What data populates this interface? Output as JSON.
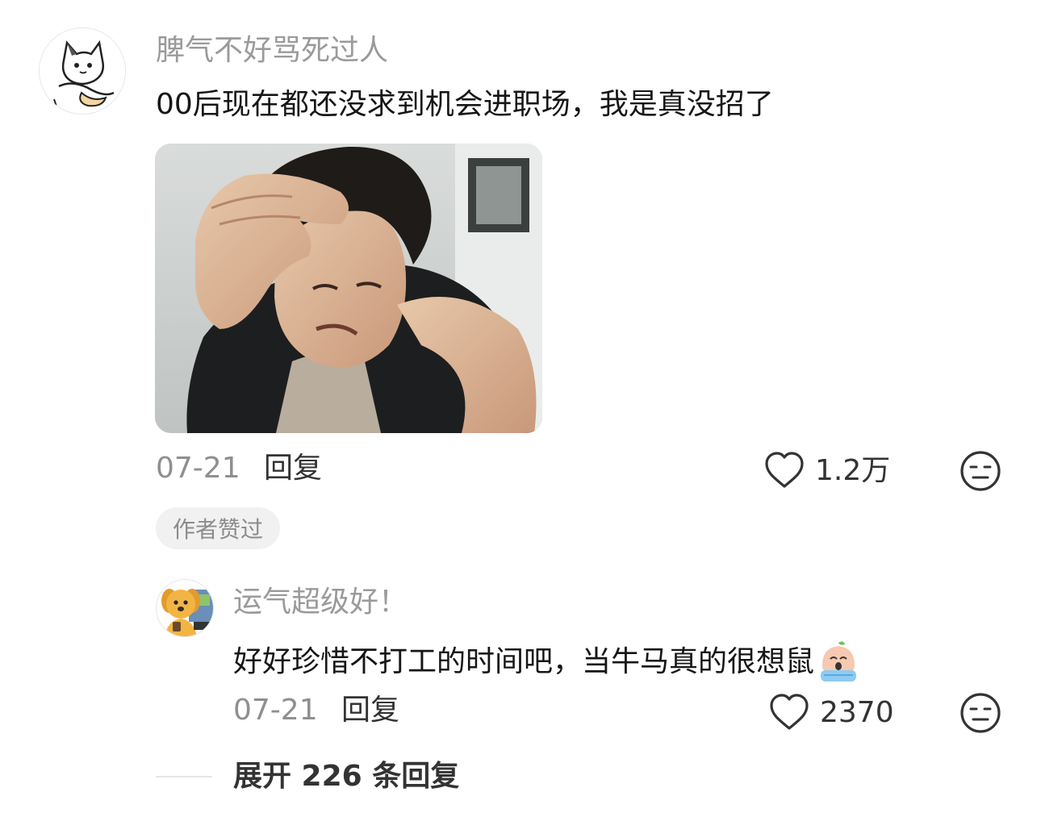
{
  "comment": {
    "username": "脾气不好骂死过人",
    "text": "00后现在都还没求到机会进职场，我是真没招了",
    "date": "07-21",
    "reply_label": "回复",
    "like_count": "1.2万",
    "author_badge": "作者赞过",
    "icons": {
      "avatar": "cat-avatar",
      "like": "heart-icon",
      "dislike": "meh-face-icon"
    }
  },
  "reply": {
    "username": "运气超级好！",
    "text": "好好珍惜不打工的时间吧，当牛马真的很想鼠",
    "date": "07-21",
    "reply_label": "回复",
    "like_count": "2370",
    "icons": {
      "avatar": "dog-avatar",
      "emoji": "crying-peach-emoji",
      "like": "heart-icon",
      "dislike": "meh-face-icon"
    }
  },
  "expand": {
    "label": "展开 226 条回复"
  },
  "colors": {
    "username": "#9a9a9a",
    "text": "#161616",
    "secondary": "#8f8f8f",
    "badge_bg": "#f1f1f1"
  }
}
